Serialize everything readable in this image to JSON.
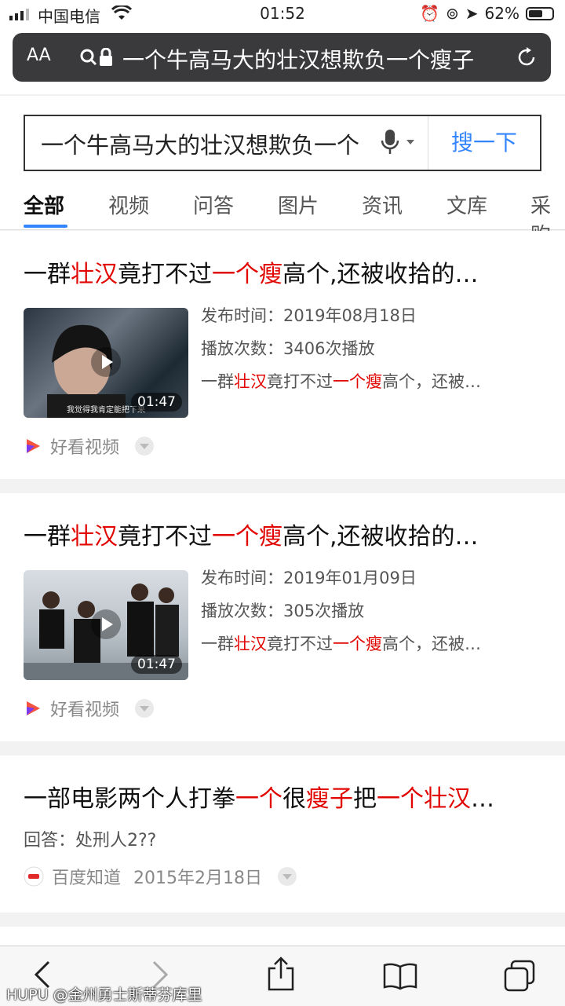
{
  "status": {
    "carrier": "中国电信",
    "time": "01:52",
    "battery": "62%",
    "battery_level": 0.62
  },
  "urlbar": {
    "aa": "AA",
    "url": "一个牛高马大的壮汉想欺负一个瘦子"
  },
  "search": {
    "query": "一个牛高马大的壮汉想欺负一个",
    "button": "搜一下"
  },
  "tabs": [
    "全部",
    "视频",
    "问答",
    "图片",
    "资讯",
    "文库",
    "采购"
  ],
  "results": [
    {
      "title_parts": [
        "一群",
        "壮汉",
        "竟打不过",
        "一个瘦",
        "高个,还被收拾的…"
      ],
      "publish": "发布时间：2019年08月18日",
      "plays": "播放次数：3406次播放",
      "snippet_parts": [
        "一群",
        "壮汉",
        "竟打不过",
        "一个瘦",
        "高个，还被…"
      ],
      "duration": "01:47",
      "thumb_caption": "我觉得我肯定能把下来",
      "source": "好看视频"
    },
    {
      "title_parts": [
        "一群",
        "壮汉",
        "竟打不过",
        "一个瘦",
        "高个,还被收拾的…"
      ],
      "publish": "发布时间：2019年01月09日",
      "plays": "播放次数：305次播放",
      "snippet_parts": [
        "一群",
        "壮汉",
        "竟打不过",
        "一个瘦",
        "高个，还被…"
      ],
      "duration": "01:47",
      "source": "好看视频"
    },
    {
      "title_parts": [
        "一部电影两个人打拳",
        "一个",
        "很",
        "瘦子",
        "把",
        "一个壮汉",
        "…"
      ],
      "answer": "回答：处刑人2??",
      "source": "百度知道",
      "date": "2015年2月18日"
    }
  ],
  "watermark": "HUPU @金州勇士斯蒂芬库里",
  "colors": {
    "highlight": "#e10601",
    "accent": "#3385ff"
  }
}
